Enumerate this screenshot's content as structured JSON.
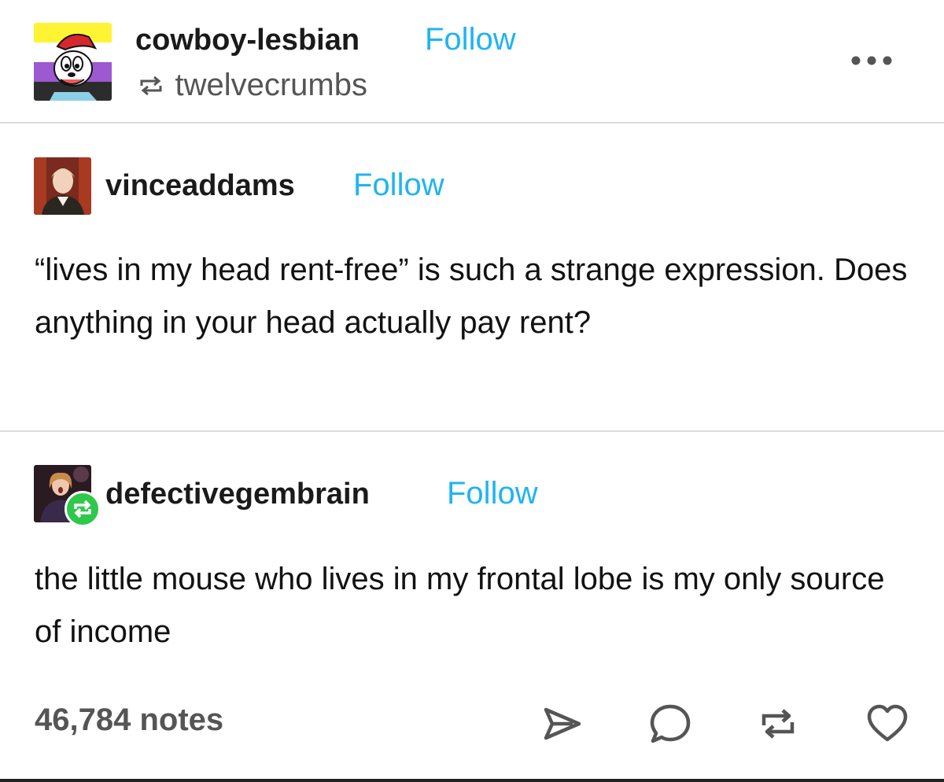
{
  "header": {
    "username": "cowboy-lesbian",
    "follow_label": "Follow",
    "reblogged_from": "twelvecrumbs",
    "avatar_icon": "cartoon-avatar-icon",
    "more_icon": "more-options-icon"
  },
  "posts": [
    {
      "username": "vinceaddams",
      "follow_label": "Follow",
      "text": "“lives in my head rent-free” is such a strange expression. Does anything in your head actually pay rent?"
    },
    {
      "username": "defectivegembrain",
      "follow_label": "Follow",
      "text": "the little mouse who lives in my frontal lobe is my only source of income",
      "badge_icon": "reblog-badge-icon"
    }
  ],
  "footer": {
    "notes": "46,784 notes",
    "actions": [
      "share-icon",
      "reply-icon",
      "reblog-icon",
      "like-icon"
    ]
  },
  "colors": {
    "follow": "#1fb4f2",
    "reblog_badge": "#2ec84a",
    "divider": "#dcdcdc",
    "notes_text": "#555555"
  }
}
